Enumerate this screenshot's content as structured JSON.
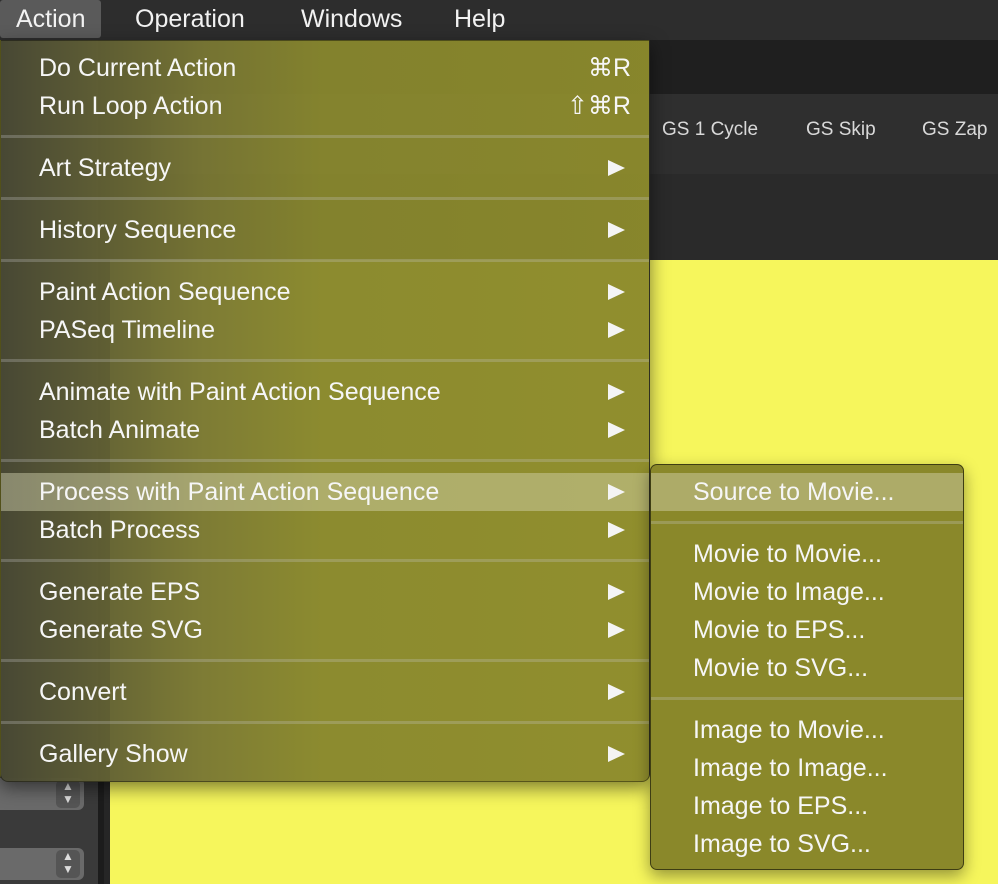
{
  "menubar": {
    "items": [
      "Action",
      "Operation",
      "Windows",
      "Help"
    ]
  },
  "toolbar": {
    "buttons": [
      "GS 1 Cycle",
      "GS Skip",
      "GS Zap"
    ]
  },
  "action_menu": {
    "do_current_action": {
      "label": "Do Current Action",
      "shortcut": "⌘R"
    },
    "run_loop_action": {
      "label": "Run Loop Action",
      "shortcut": "⇧⌘R"
    },
    "art_strategy": "Art Strategy",
    "history_sequence": "History Sequence",
    "paint_action_sequence": "Paint Action Sequence",
    "paseq_timeline": "PASeq Timeline",
    "animate_with_pas": "Animate with Paint Action Sequence",
    "batch_animate": "Batch Animate",
    "process_with_pas": "Process with Paint Action Sequence",
    "batch_process": "Batch Process",
    "generate_eps": "Generate EPS",
    "generate_svg": "Generate SVG",
    "convert": "Convert",
    "gallery_show": "Gallery Show"
  },
  "submenu": {
    "source_to_movie": "Source to Movie...",
    "movie_to_movie": "Movie to Movie...",
    "movie_to_image": "Movie to Image...",
    "movie_to_eps": "Movie to EPS...",
    "movie_to_svg": "Movie to SVG...",
    "image_to_movie": "Image to Movie...",
    "image_to_image": "Image to Image...",
    "image_to_eps": "Image to EPS...",
    "image_to_svg": "Image to SVG..."
  },
  "colors": {
    "canvas": "#f6f65c",
    "menu_tint": "#8a882a",
    "highlight": "#bdbd8a"
  }
}
